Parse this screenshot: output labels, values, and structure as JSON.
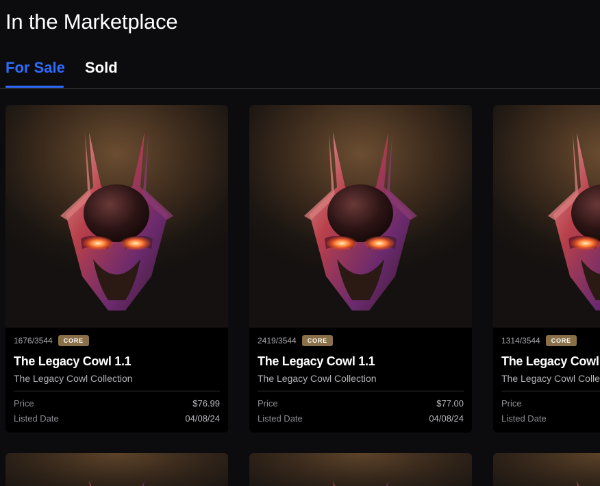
{
  "page": {
    "title": "In the Marketplace"
  },
  "tabs": [
    {
      "label": "For Sale",
      "active": true
    },
    {
      "label": "Sold",
      "active": false
    }
  ],
  "colors": {
    "accent": "#2f6bff",
    "badge": "#8a7048",
    "background": "#0c0c0e",
    "card": "#000000"
  },
  "cards": [
    {
      "edition": "1676/3544",
      "badge": "CORE",
      "name": "The Legacy Cowl 1.1",
      "collection": "The Legacy Cowl Collection",
      "price_label": "Price",
      "price": "$76.99",
      "date_label": "Listed Date",
      "date": "04/08/24",
      "image": "red-cowl-mask"
    },
    {
      "edition": "2419/3544",
      "badge": "CORE",
      "name": "The Legacy Cowl 1.1",
      "collection": "The Legacy Cowl Collection",
      "price_label": "Price",
      "price": "$77.00",
      "date_label": "Listed Date",
      "date": "04/08/24",
      "image": "red-cowl-mask"
    },
    {
      "edition": "1314/3544",
      "badge": "CORE",
      "name": "The Legacy Cowl",
      "collection": "The Legacy Cowl Colle",
      "price_label": "Price",
      "price": "",
      "date_label": "Listed Date",
      "date": "",
      "image": "red-cowl-mask"
    }
  ]
}
